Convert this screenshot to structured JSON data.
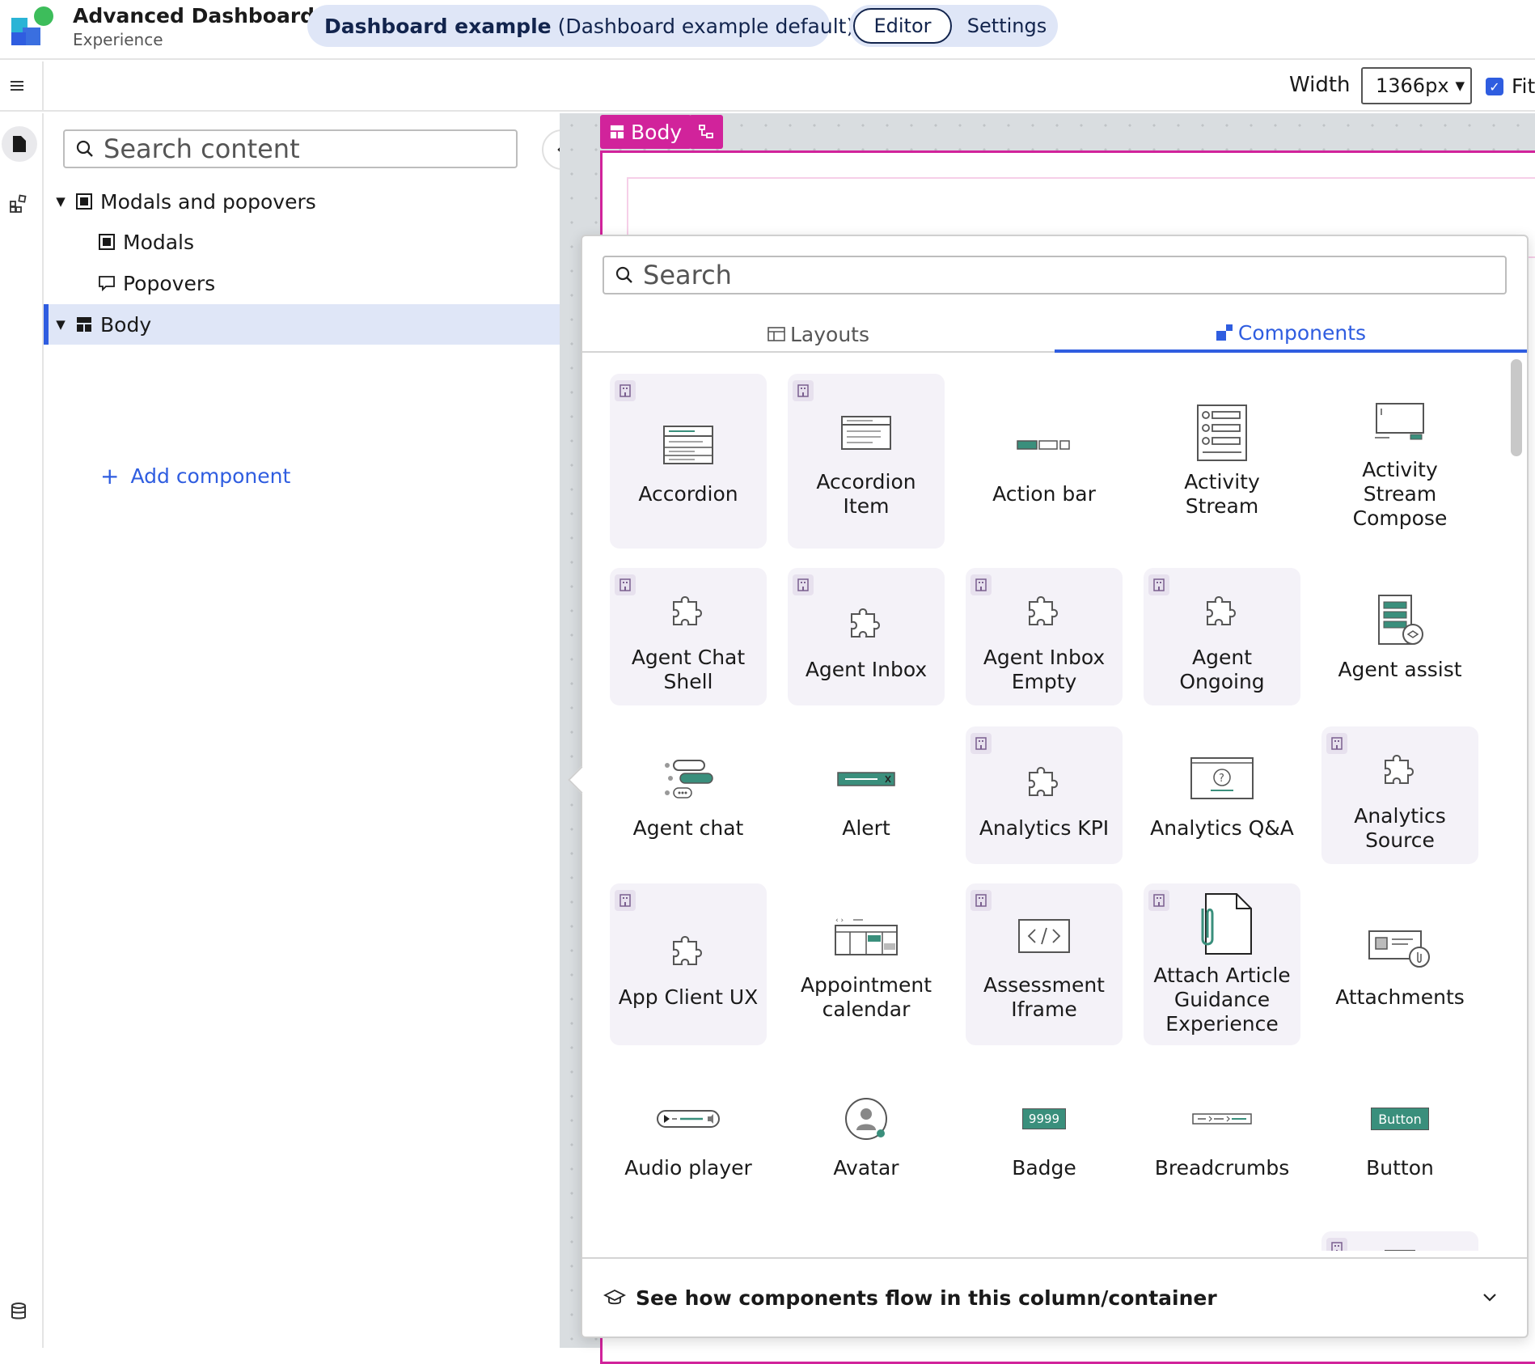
{
  "app": {
    "title": "Advanced Dashboards",
    "subtitle": "Experience",
    "page_name": "Dashboard example",
    "page_variant": "(Dashboard example default)",
    "modes": [
      "Editor",
      "Settings"
    ],
    "active_mode": "Editor"
  },
  "toolbar": {
    "width_label": "Width",
    "width_value": "1366px",
    "fit_label": "Fit",
    "fit_checked": true
  },
  "tree": {
    "search_placeholder": "Search content",
    "items": [
      {
        "label": "Modals and popovers",
        "expanded": true,
        "level": 0,
        "icon": "modal-icon"
      },
      {
        "label": "Modals",
        "level": 1,
        "icon": "modal-icon"
      },
      {
        "label": "Popovers",
        "level": 1,
        "icon": "popover-icon"
      },
      {
        "label": "Body",
        "expanded": true,
        "level": 0,
        "icon": "layout-icon",
        "selected": true
      }
    ],
    "add_label": "Add component"
  },
  "canvas": {
    "body_tag": "Body"
  },
  "picker": {
    "search_placeholder": "Search",
    "tabs": [
      {
        "label": "Layouts",
        "active": false
      },
      {
        "label": "Components",
        "active": true
      }
    ],
    "components": [
      {
        "label": "Accordion",
        "custom": true,
        "icon": "accordion-icon"
      },
      {
        "label": "Accordion Item",
        "custom": true,
        "icon": "accordion-item-icon"
      },
      {
        "label": "Action bar",
        "custom": false,
        "icon": "action-bar-icon"
      },
      {
        "label": "Activity Stream",
        "custom": false,
        "icon": "activity-stream-icon"
      },
      {
        "label": "Activity Stream Compose",
        "custom": false,
        "icon": "activity-compose-icon"
      },
      {
        "label": "Agent Chat Shell",
        "custom": true,
        "icon": "puzzle-icon"
      },
      {
        "label": "Agent Inbox",
        "custom": true,
        "icon": "puzzle-icon"
      },
      {
        "label": "Agent Inbox Empty",
        "custom": true,
        "icon": "puzzle-icon"
      },
      {
        "label": "Agent Ongoing",
        "custom": true,
        "icon": "puzzle-icon"
      },
      {
        "label": "Agent assist",
        "custom": false,
        "icon": "agent-assist-icon"
      },
      {
        "label": "Agent chat",
        "custom": false,
        "icon": "agent-chat-icon"
      },
      {
        "label": "Alert",
        "custom": false,
        "icon": "alert-icon"
      },
      {
        "label": "Analytics KPI",
        "custom": true,
        "icon": "puzzle-icon"
      },
      {
        "label": "Analytics Q&A",
        "custom": false,
        "icon": "analytics-qa-icon"
      },
      {
        "label": "Analytics Source",
        "custom": true,
        "icon": "puzzle-icon"
      },
      {
        "label": "App Client UX",
        "custom": true,
        "icon": "puzzle-icon"
      },
      {
        "label": "Appointment calendar",
        "custom": false,
        "icon": "calendar-icon"
      },
      {
        "label": "Assessment Iframe",
        "custom": true,
        "icon": "code-icon"
      },
      {
        "label": "Attach Article Guidance Experience",
        "custom": true,
        "icon": "paperclip-doc-icon"
      },
      {
        "label": "Attachments",
        "custom": false,
        "icon": "attachments-icon"
      },
      {
        "label": "Audio player",
        "custom": false,
        "icon": "audio-player-icon"
      },
      {
        "label": "Avatar",
        "custom": false,
        "icon": "avatar-icon"
      },
      {
        "label": "Badge",
        "custom": false,
        "icon": "badge-icon",
        "icon_text": "9999"
      },
      {
        "label": "Breadcrumbs",
        "custom": false,
        "icon": "breadcrumbs-icon"
      },
      {
        "label": "Button",
        "custom": false,
        "icon": "button-icon",
        "icon_text": "Button"
      }
    ],
    "footer_text": "See how components flow in this column/container"
  },
  "colors": {
    "accent": "#2f5de0",
    "canvas_magenta": "#d1239b",
    "teal": "#3a8f7c",
    "custom_tile_bg": "#f4f2f8",
    "selected_row_bg": "#dfe6f7"
  }
}
